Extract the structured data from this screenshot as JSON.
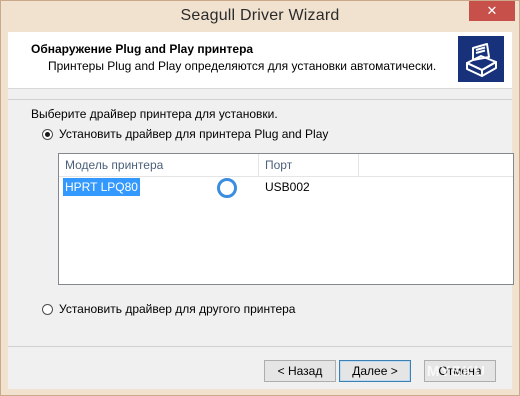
{
  "window": {
    "title": "Seagull Driver Wizard",
    "close_glyph": "✕"
  },
  "header": {
    "title": "Обнаружение Plug and Play принтера",
    "subtitle": "Принтеры Plug and Play определяются для установки автоматически.",
    "icon": "printer-icon"
  },
  "main": {
    "select_label": "Выберите драйвер принтера для установки.",
    "option_pnp": {
      "label": "Установить драйвер для принтера Plug and Play",
      "checked": true
    },
    "option_other": {
      "label": "Установить драйвер для другого принтера",
      "checked": false
    },
    "printer_list": {
      "columns": [
        "Модель принтера",
        "Порт"
      ],
      "rows": [
        {
          "model": "HPRT LPQ80",
          "port": "USB002",
          "selected": true
        }
      ]
    }
  },
  "footer": {
    "back_label": "< Назад",
    "next_label": "Далее >",
    "cancel_label": "Отмена",
    "watermark": "MYSKU"
  }
}
